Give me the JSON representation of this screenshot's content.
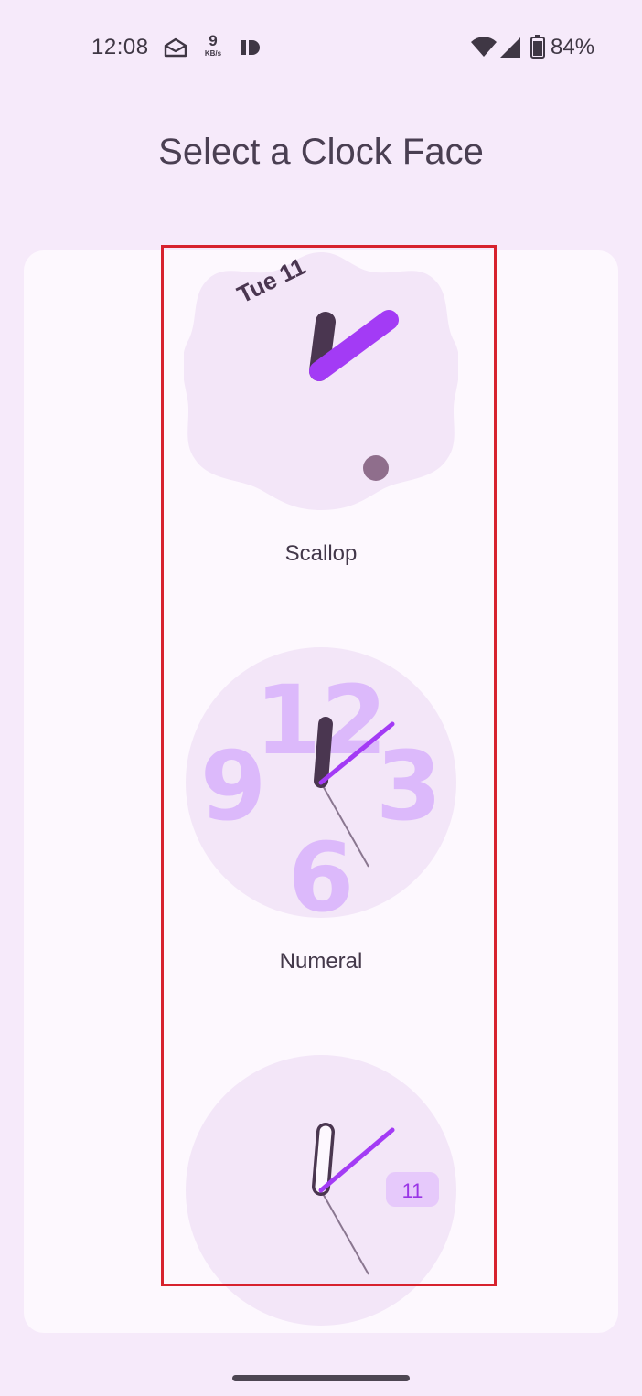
{
  "status_bar": {
    "time": "12:08",
    "net_speed_value": "9",
    "net_speed_unit": "KB/s",
    "battery_percent": "84%"
  },
  "page": {
    "title": "Select a Clock Face"
  },
  "clock_faces": [
    {
      "label": "Scallop",
      "date_text": "Tue 11"
    },
    {
      "label": "Numeral",
      "numerals": [
        "12",
        "3",
        "6",
        "9"
      ]
    },
    {
      "label": "",
      "date_badge": "11"
    }
  ],
  "colors": {
    "background": "#f6eafa",
    "card": "#fdf8fe",
    "face": "#f3e6f8",
    "hour_hand": "#4a3650",
    "minute_hand": "#a33bf5",
    "numeral": "#dcb9fb",
    "selection": "#d7222e"
  }
}
